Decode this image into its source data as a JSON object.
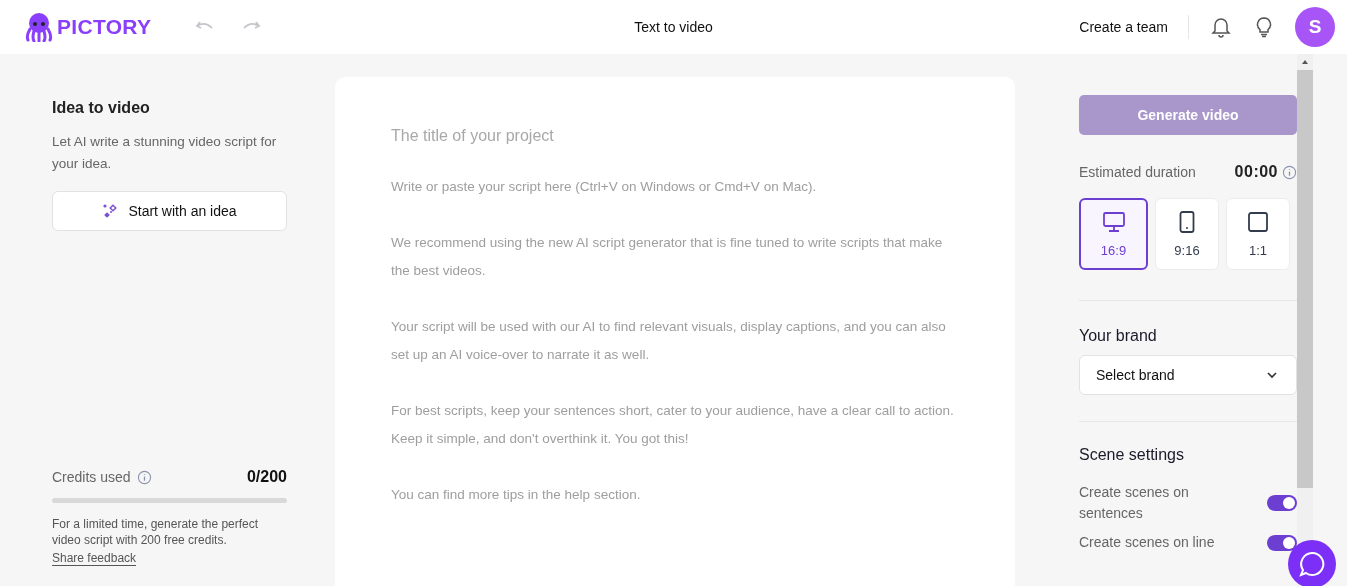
{
  "header": {
    "logo": "PICTORY",
    "title": "Text to video",
    "team_link": "Create a team",
    "avatar": "S"
  },
  "idea_panel": {
    "heading": "Idea to video",
    "description": "Let AI write a stunning video script for your idea.",
    "button": "Start with an idea"
  },
  "credits": {
    "label": "Credits used",
    "value": "0/200",
    "note": "For a limited time, generate the perfect video script with 200 free credits.",
    "link": "Share feedback"
  },
  "editor": {
    "title_placeholder": "The title of your project",
    "script_placeholder": "Write or paste your script here (Ctrl+V on Windows or Cmd+V on Mac).\n\nWe recommend using the new AI script generator that is fine tuned to write scripts that make the best videos.\n\nYour script will be used with our AI to find relevant visuals, display captions, and you can also set up an AI voice-over to narrate it as well.\n\nFor best scripts, keep your sentences short, cater to your audience, have a clear call to action. Keep it simple, and don't overthink it. You got this!\n\nYou can find more tips in the help section."
  },
  "settings": {
    "generate_button": "Generate video",
    "generate_disabled": true,
    "duration_label": "Estimated duration",
    "duration": "00:00",
    "aspect_ratios": [
      {
        "kind": "landscape",
        "label": "16:9",
        "selected": true
      },
      {
        "kind": "portrait",
        "label": "9:16",
        "selected": false
      },
      {
        "kind": "square",
        "label": "1:1",
        "selected": false
      }
    ],
    "brand_heading": "Your brand",
    "brand_select": "Select brand",
    "scene_heading": "Scene settings",
    "scene_options": [
      {
        "label": "Create scenes on sentences",
        "on": true
      },
      {
        "label": "Create scenes on line",
        "on": true
      }
    ]
  }
}
